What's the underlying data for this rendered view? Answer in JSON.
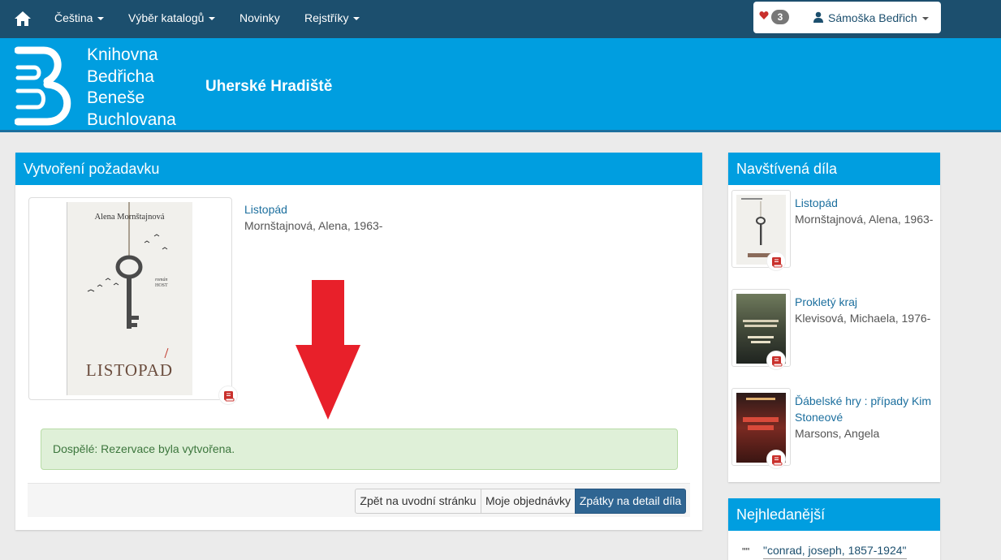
{
  "navbar": {
    "items": [
      {
        "label": "Čeština",
        "dropdown": true
      },
      {
        "label": "Výběr katalogů",
        "dropdown": true
      },
      {
        "label": "Novinky",
        "dropdown": false
      },
      {
        "label": "Rejstříky",
        "dropdown": true
      }
    ],
    "favorites_count": "3",
    "user_name": "Sámoška Bedřich"
  },
  "banner": {
    "library_name": [
      "Knihovna",
      "Bedřicha",
      "Beneše",
      "Buchlovana"
    ],
    "city": "Uherské Hradiště"
  },
  "main": {
    "title": "Vytvoření požadavku",
    "book": {
      "title": "Listopád",
      "author": "Mornštajnová, Alena, 1963-",
      "cover_author": "Alena Mornštajnová",
      "cover_sub": [
        "román",
        "HOST"
      ],
      "cover_title": "LISTOPAD"
    },
    "alert": "Dospělé: Rezervace byla vytvořena.",
    "buttons": {
      "home": "Zpět na uvodní stránku",
      "orders": "Moje objednávky",
      "detail": "Zpátky na detail díla"
    }
  },
  "visited": {
    "title": "Navštívená díla",
    "items": [
      {
        "title": "Listopád",
        "author": "Mornštajnová, Alena, 1963-"
      },
      {
        "title": "Prokletý kraj",
        "author": "Klevisová, Michaela, 1976-"
      },
      {
        "title": "Ďábelské hry : případy Kim Stoneové",
        "author": "Marsons, Angela"
      }
    ]
  },
  "popular": {
    "title": "Nejhledanější",
    "quote": "\"\"",
    "item": "\"conrad, joseph, 1857-1924\""
  },
  "colors": {
    "navbar": "#1c4f6e",
    "brand": "#009ee0",
    "alert_bg": "#dff0d8",
    "primary_button": "#2f6592",
    "arrow": "#e8202a"
  }
}
